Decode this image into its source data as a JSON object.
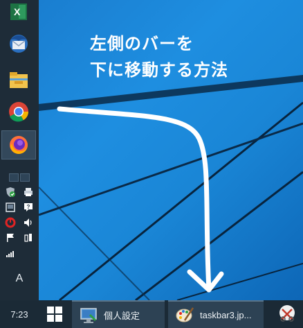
{
  "desktop": {
    "headline_line1": "左側のバーを",
    "headline_line2": "下に移動する方法"
  },
  "left_taskbar": {
    "pinned_apps": [
      {
        "name": "excel-icon"
      },
      {
        "name": "thunderbird-icon"
      },
      {
        "name": "file-explorer-icon"
      },
      {
        "name": "chrome-icon"
      },
      {
        "name": "firefox-icon",
        "active": true
      }
    ],
    "tray_icons": [
      "defender-icon",
      "printer-icon",
      "tablet-icon",
      "chat-icon",
      "antivirus-icon",
      "volume-icon",
      "flag-icon",
      "power-icon",
      "signal-icon"
    ],
    "ime_label": "A"
  },
  "bottom_taskbar": {
    "clock": "7:23",
    "tasks": [
      {
        "label": "個人設定",
        "icon": "personalize-icon"
      },
      {
        "label": "taskbar3.jp...",
        "icon": "paint-icon"
      }
    ],
    "tray_icon": "snipping-tool-icon"
  },
  "colors": {
    "wallpaper": "#1a86d6",
    "taskbar": "#1e2c38",
    "arrow": "#ffffff"
  }
}
